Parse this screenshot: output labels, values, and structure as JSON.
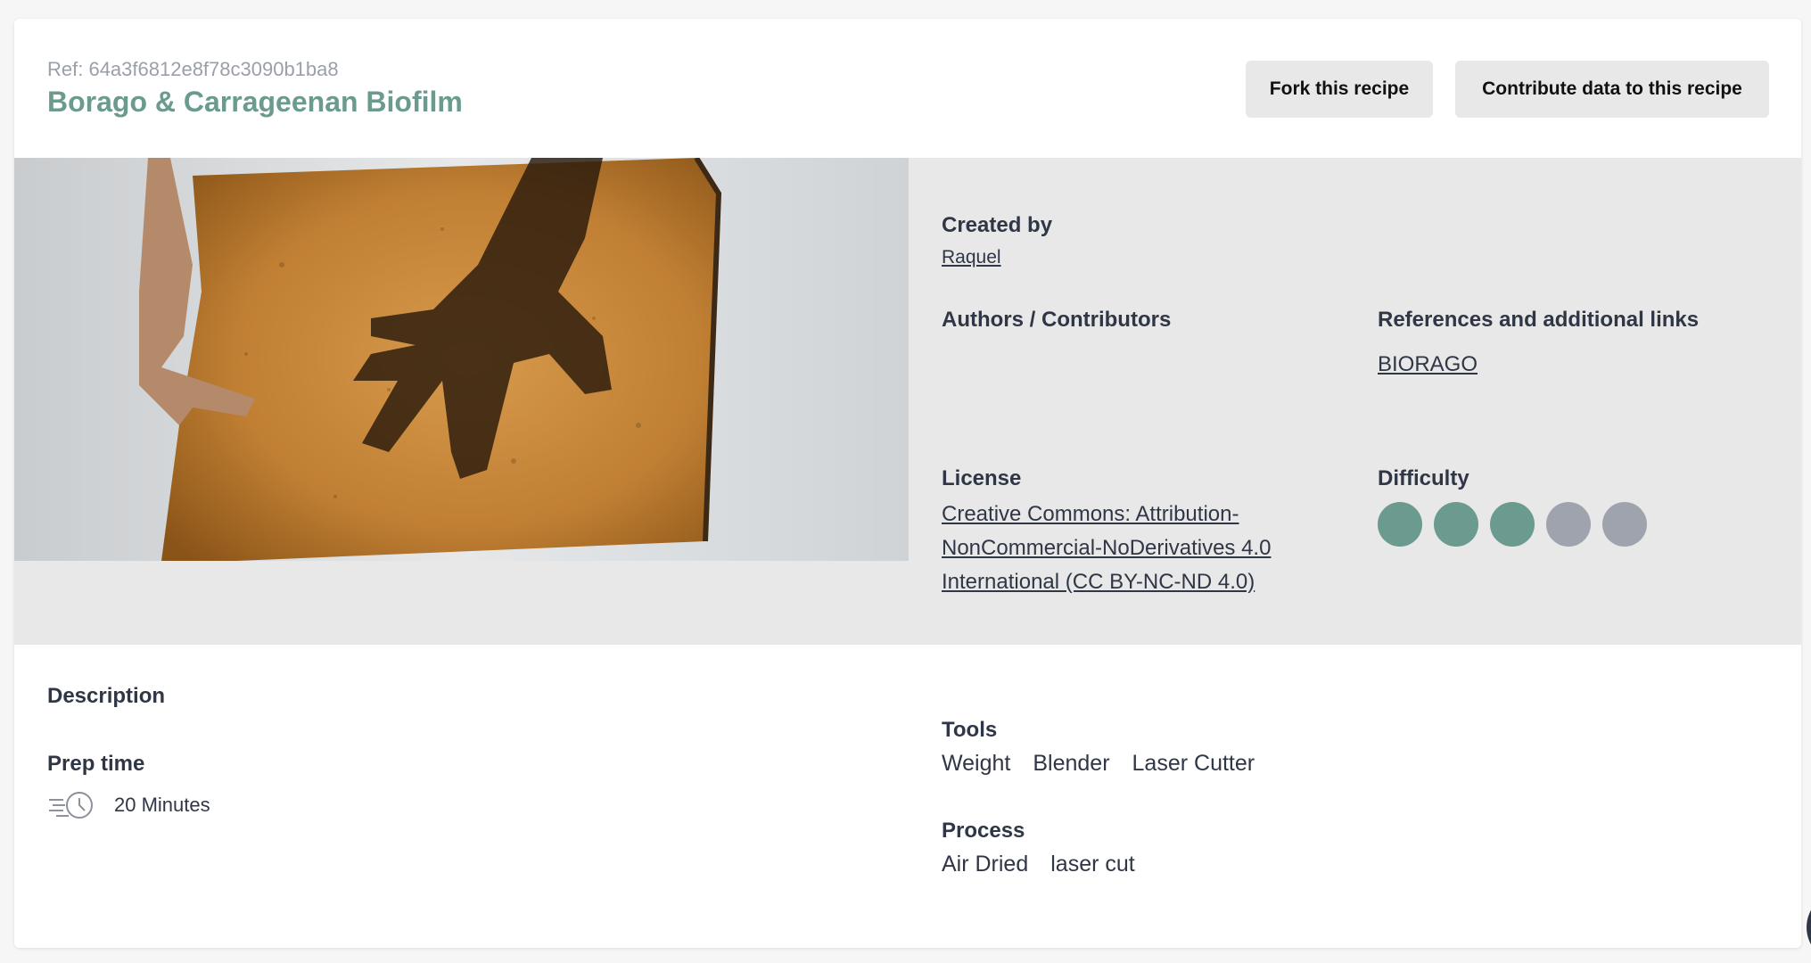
{
  "header": {
    "ref": "Ref: 64a3f6812e8f78c3090b1ba8",
    "title": "Borago & Carrageenan Biofilm",
    "fork_label": "Fork this recipe",
    "contribute_label": "Contribute data to this recipe"
  },
  "info": {
    "created_by_label": "Created by",
    "created_by_value": "Raquel",
    "authors_label": "Authors / Contributors",
    "references_label": "References and additional links",
    "references_link": "BIORAGO",
    "license_label": "License",
    "license_value": "Creative Commons: Attribution-NonCommercial-NoDerivatives 4.0 International (CC BY-NC-ND 4.0)",
    "difficulty_label": "Difficulty",
    "difficulty_level": 3,
    "difficulty_max": 5
  },
  "details": {
    "description_label": "Description",
    "prep_time_label": "Prep time",
    "prep_time_value": "20 Minutes",
    "tools_label": "Tools",
    "tools": [
      "Weight",
      "Blender",
      "Laser Cutter"
    ],
    "process_label": "Process",
    "process": [
      "Air Dried",
      "laser cut"
    ]
  },
  "colors": {
    "accent": "#6b9a8e",
    "inactive_dot": "#9fa3ad",
    "panel_bg": "#e8e8e8",
    "text": "#2f3645"
  },
  "icons": {
    "prep_time": "fast-clock-icon"
  }
}
